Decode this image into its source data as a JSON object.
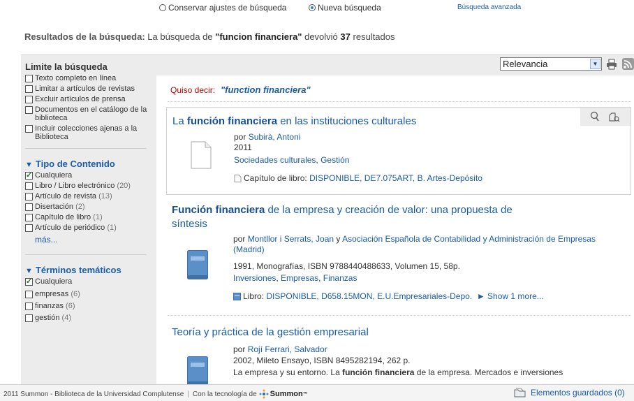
{
  "top": {
    "keep_settings": "Conservar ajustes de búsqueda",
    "new_search": "Nueva búsqueda",
    "advanced": "Búsqueda avanzada"
  },
  "summary": {
    "label": "Resultados de la búsqueda:",
    "pre": "La búsqueda de",
    "query": "\"funcion financiera\"",
    "mid": "devolvió",
    "count": "37",
    "post": "resultados"
  },
  "sidebar": {
    "limit_title": "Limite la búsqueda",
    "limits": [
      "Texto completo en línea",
      "Limitar a artículos de revistas",
      "Excluir artículos de prensa",
      "Documentos en el catálogo de la biblioteca",
      "Incluir colecciones ajenas a la Biblioteca"
    ],
    "content_type": {
      "title": "Tipo de Contenido",
      "any": "Cualquiera",
      "items": [
        {
          "label": "Libro / Libro electrónico",
          "count": "(20)"
        },
        {
          "label": "Artículo de revista",
          "count": "(13)"
        },
        {
          "label": "Disertación",
          "count": "(2)"
        },
        {
          "label": "Capítulo de libro",
          "count": "(1)"
        },
        {
          "label": "Artículo de periódico",
          "count": "(1)"
        }
      ],
      "more": "más..."
    },
    "subjects": {
      "title": "Términos temáticos",
      "any": "Cualquiera",
      "items": [
        {
          "label": "empresas",
          "count": "(6)"
        },
        {
          "label": "finanzas",
          "count": "(6)"
        },
        {
          "label": "gestión",
          "count": "(4)"
        }
      ]
    }
  },
  "sort": {
    "selected": "Relevancia"
  },
  "didyoumean": {
    "label": "Quiso decir:",
    "suggestion": "\"function financiera\""
  },
  "results": [
    {
      "title_pre": "La ",
      "title_bold": "función financiera",
      "title_post": " en las instituciones culturales",
      "by": "por",
      "author": "Subirà, Antoni",
      "year": "2011",
      "subject1": "Sociedades culturales",
      "subject2": "Gestión",
      "avail_pre": "Capítulo de libro:",
      "avail_link": "DISPONIBLE, DE7.075ART, B. Artes-Depósito"
    },
    {
      "title_bold": "Función financiera",
      "title_post": " de la empresa y creación de valor: una propuesta de",
      "title_line2": "síntesis",
      "by": "por",
      "author1": "Montllor i Serrats, Joan",
      "and": "y",
      "author2": "Asociación Española de Contabilidad y Administración de Empresas",
      "author2b": "(Madrid)",
      "details": "1991, Monografías, ISBN 9788440488633, Volumen 15, 58p.",
      "subject1": "Inversiones",
      "subject2": "Empresas",
      "subject3": "Finanzas",
      "avail_pre": "Libro:",
      "avail_link": "DISPONIBLE, D658.15MON, E.U.Empresariales-Depo.",
      "show_more": "► Show 1 more..."
    },
    {
      "title": "Teoría y práctica de la gestión empresarial",
      "by": "por",
      "author": "Rojí Ferrari, Salvador",
      "details": "2002, Mileto Ensayo, ISBN 8495282194, 262 p.",
      "abstract_pre": "La empresa y su entorno. La ",
      "abstract_bold": "función financiera",
      "abstract_post": " de la empresa. Mercados e inversiones"
    }
  ],
  "footer": {
    "copyright": "2011 Summon - Biblioteca de la Universidad Complutense",
    "powered": "Con la tecnología de",
    "brand": "Summon",
    "tm": "™",
    "saved": "Elementos guardados (0)"
  }
}
